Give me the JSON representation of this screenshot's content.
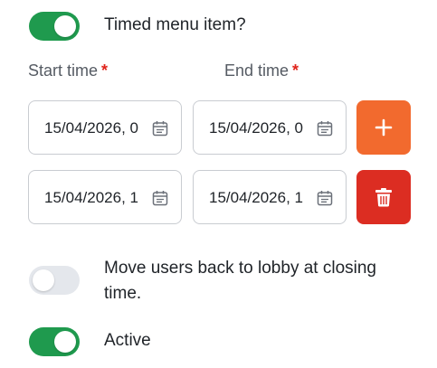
{
  "timed": {
    "label": "Timed menu item?",
    "enabled": true
  },
  "fields": {
    "start_label": "Start time",
    "end_label": "End time",
    "required_marker": "*"
  },
  "rows": [
    {
      "start_value": "15/04/2026, 0",
      "end_value": "15/04/2026, 0",
      "action": "add",
      "action_color": "#f26a2e"
    },
    {
      "start_value": "15/04/2026, 1",
      "end_value": "15/04/2026, 1",
      "action": "delete",
      "action_color": "#dc2d22"
    }
  ],
  "lobby": {
    "label_line1": "Move users back to lobby at closing",
    "label_line2": "time.",
    "enabled": false
  },
  "active": {
    "label": "Active",
    "enabled": true
  },
  "colors": {
    "toggle_on": "#1f9a4e",
    "toggle_off": "#e4e7ec",
    "required": "#e0241b"
  },
  "icons": {
    "calendar": "calendar-icon",
    "add": "plus-icon",
    "delete": "trash-icon"
  }
}
